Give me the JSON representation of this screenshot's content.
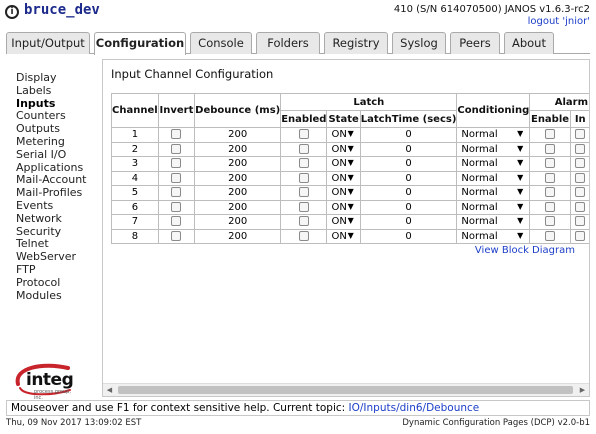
{
  "header": {
    "hostname": "bruce_dev",
    "device_info": "410 (S/N 614070500) JANOS v1.6.3-rc2",
    "logout_label": "logout 'jnior'"
  },
  "tabs": [
    {
      "label": "Input/Output",
      "active": false
    },
    {
      "label": "Configuration",
      "active": true
    },
    {
      "label": "Console",
      "active": false
    },
    {
      "label": "Folders",
      "active": false
    },
    {
      "label": "Registry",
      "active": false
    },
    {
      "label": "Syslog",
      "active": false
    },
    {
      "label": "Peers",
      "active": false
    },
    {
      "label": "About",
      "active": false
    }
  ],
  "sidebar": {
    "items": [
      {
        "label": "Display",
        "active": false
      },
      {
        "label": "Labels",
        "active": false
      },
      {
        "label": "Inputs",
        "active": true
      },
      {
        "label": "Counters",
        "active": false
      },
      {
        "label": "Outputs",
        "active": false
      },
      {
        "label": "Metering",
        "active": false
      },
      {
        "label": "Serial I/O",
        "active": false
      },
      {
        "label": "Applications",
        "active": false
      },
      {
        "label": "Mail-Account",
        "active": false
      },
      {
        "label": "Mail-Profiles",
        "active": false
      },
      {
        "label": "Events",
        "active": false
      },
      {
        "label": "Network",
        "active": false
      },
      {
        "label": "Security",
        "active": false
      },
      {
        "label": "Telnet",
        "active": false
      },
      {
        "label": "WebServer",
        "active": false
      },
      {
        "label": "FTP",
        "active": false
      },
      {
        "label": "Protocol",
        "active": false
      },
      {
        "label": "Modules",
        "active": false
      }
    ]
  },
  "logo": {
    "word": "integ",
    "tagline": "process group, inc."
  },
  "main": {
    "title": "Input Channel Configuration",
    "headers": {
      "channel": "Channel",
      "invert": "Invert",
      "debounce": "Debounce (ms)",
      "latch": "Latch",
      "conditioning": "Conditioning",
      "alarm": "Alarm",
      "latch_enabled": "Enabled",
      "latch_state": "State",
      "latch_time": "LatchTime (secs)",
      "alarm_enable": "Enable",
      "alarm_in": "In"
    },
    "rows": [
      {
        "channel": "1",
        "debounce": "200",
        "state": "ON",
        "latch_time": "0",
        "conditioning": "Normal"
      },
      {
        "channel": "2",
        "debounce": "200",
        "state": "ON",
        "latch_time": "0",
        "conditioning": "Normal"
      },
      {
        "channel": "3",
        "debounce": "200",
        "state": "ON",
        "latch_time": "0",
        "conditioning": "Normal"
      },
      {
        "channel": "4",
        "debounce": "200",
        "state": "ON",
        "latch_time": "0",
        "conditioning": "Normal"
      },
      {
        "channel": "5",
        "debounce": "200",
        "state": "ON",
        "latch_time": "0",
        "conditioning": "Normal"
      },
      {
        "channel": "6",
        "debounce": "200",
        "state": "ON",
        "latch_time": "0",
        "conditioning": "Normal"
      },
      {
        "channel": "7",
        "debounce": "200",
        "state": "ON",
        "latch_time": "0",
        "conditioning": "Normal"
      },
      {
        "channel": "8",
        "debounce": "200",
        "state": "ON",
        "latch_time": "0",
        "conditioning": "Normal"
      }
    ],
    "view_block_diagram": "View Block Diagram"
  },
  "helpbar": {
    "text": "Mouseover and use F1 for context sensitive help. Current topic: ",
    "topic": "IO/Inputs/din6/Debounce"
  },
  "statusbar": {
    "datetime": "Thu, 09 Nov 2017 13:09:02 EST",
    "version": "Dynamic Configuration Pages (DCP) v2.0-b1"
  },
  "colors": {
    "link": "#1c3ec9",
    "hostname": "#1c2a8c",
    "logo_red": "#c8242b"
  }
}
